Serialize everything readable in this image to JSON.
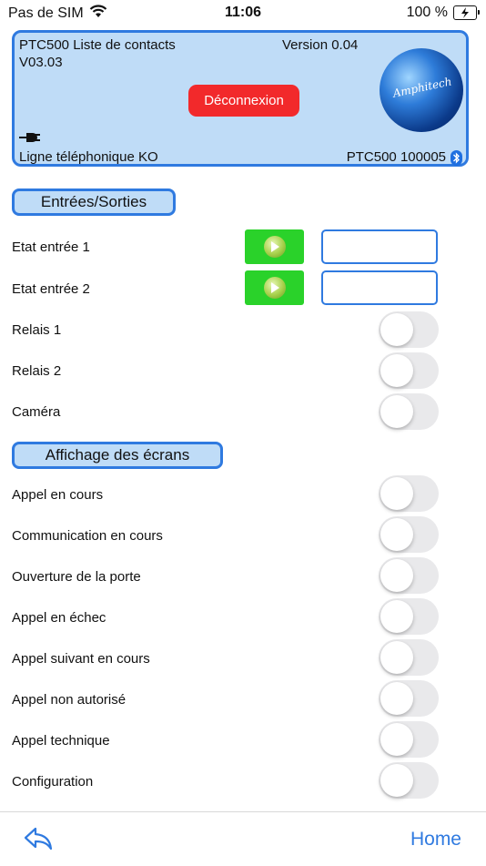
{
  "status_bar": {
    "carrier": "Pas de SIM",
    "time": "11:06",
    "battery": "100 %",
    "battery_level": 1.0
  },
  "header": {
    "title": "PTC500 Liste de contacts",
    "version": "Version 0.04",
    "firmware": "V03.03",
    "logout_label": "Déconnexion",
    "line_status": "Ligne téléphonique KO",
    "device": "PTC500 100005",
    "logo_text": "Amphitech",
    "colors": {
      "panel": "#bfdcf7",
      "border": "#2f7ae0",
      "logout": "#f2292b"
    },
    "icons": [
      "plug-icon",
      "bluetooth-icon"
    ]
  },
  "sections": {
    "io_title": "Entrées/Sorties",
    "screens_title": "Affichage des écrans"
  },
  "io": {
    "inputs": [
      {
        "label": "Etat entrée 1",
        "value": ""
      },
      {
        "label": "Etat entrée 2",
        "value": ""
      }
    ],
    "toggles": [
      {
        "label": "Relais 1",
        "on": false
      },
      {
        "label": "Relais 2",
        "on": false
      },
      {
        "label": "Caméra",
        "on": false
      }
    ]
  },
  "screens": {
    "toggles": [
      {
        "label": "Appel en cours",
        "on": false
      },
      {
        "label": "Communication en cours",
        "on": false
      },
      {
        "label": "Ouverture de la porte",
        "on": false
      },
      {
        "label": "Appel en échec",
        "on": false
      },
      {
        "label": "Appel suivant en cours",
        "on": false
      },
      {
        "label": "Appel non autorisé",
        "on": false
      },
      {
        "label": "Appel technique",
        "on": false
      },
      {
        "label": "Configuration",
        "on": false
      }
    ]
  },
  "nav": {
    "home_label": "Home",
    "back_icon": "back-arrow-icon",
    "accent": "#2f7ae0"
  }
}
